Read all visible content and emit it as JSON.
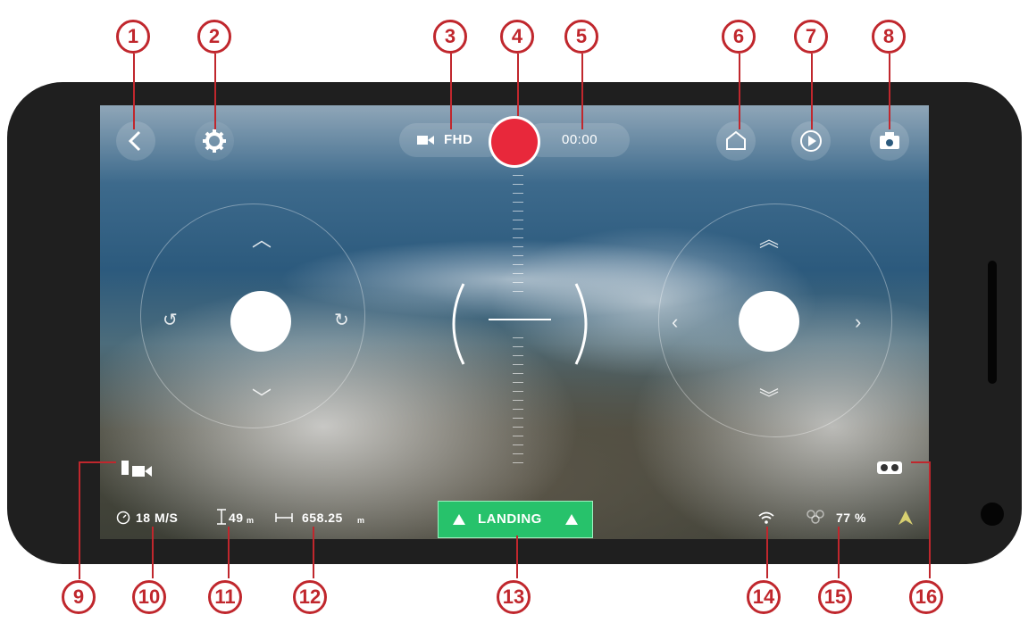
{
  "top_bar": {
    "back_icon": "chevron-left-icon",
    "settings_icon": "gear-icon",
    "video_icon": "video-camera-icon",
    "resolution": "FHD",
    "record_icon": "record-button-icon",
    "record_time": "00:00",
    "home_icon": "home-icon",
    "playback_icon": "play-icon",
    "photo_icon": "camera-icon",
    "record_color": "#e8283b"
  },
  "bottom_bar": {
    "follow_mode_icon": "follow-camera-icon",
    "speed": "18 M/S",
    "altitude": "49",
    "altitude_unit": "m",
    "distance": "658.25",
    "distance_unit": "m",
    "landing_label": "LANDING",
    "landing_color": "#27c26b",
    "signal_icon": "wifi-icon",
    "battery_value": "77 %",
    "vr_icon": "vr-headset-icon",
    "compass_icon": "compass-icon"
  },
  "markers": [
    "1",
    "2",
    "3",
    "4",
    "5",
    "6",
    "7",
    "8",
    "9",
    "10",
    "11",
    "12",
    "13",
    "14",
    "15",
    "16"
  ],
  "marker_color": "#c0272d"
}
